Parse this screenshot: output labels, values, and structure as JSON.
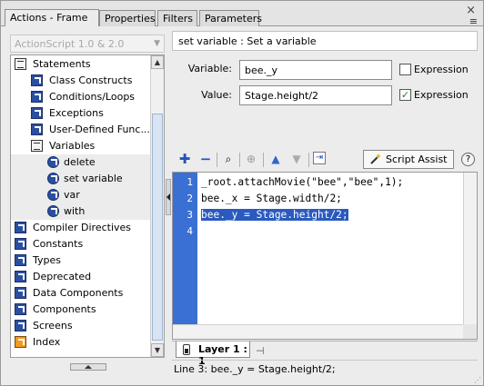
{
  "tabs": [
    {
      "label": "Actions - Frame"
    },
    {
      "label": "Properties"
    },
    {
      "label": "Filters"
    },
    {
      "label": "Parameters"
    }
  ],
  "version_select": {
    "value": "ActionScript 1.0 & 2.0"
  },
  "tree": [
    {
      "label": "Statements",
      "icon": "book-icon"
    },
    {
      "label": "Class Constructs",
      "icon": "action-icon"
    },
    {
      "label": "Conditions/Loops",
      "icon": "action-icon"
    },
    {
      "label": "Exceptions",
      "icon": "action-icon"
    },
    {
      "label": "User-Defined Func...",
      "icon": "action-icon"
    },
    {
      "label": "Variables",
      "icon": "book-icon"
    },
    {
      "label": "delete",
      "icon": "circle-action-icon"
    },
    {
      "label": "set variable",
      "icon": "circle-action-icon"
    },
    {
      "label": "var",
      "icon": "circle-action-icon"
    },
    {
      "label": "with",
      "icon": "circle-action-icon"
    },
    {
      "label": "Compiler Directives",
      "icon": "action-icon"
    },
    {
      "label": "Constants",
      "icon": "action-icon"
    },
    {
      "label": "Types",
      "icon": "action-icon"
    },
    {
      "label": "Deprecated",
      "icon": "action-icon"
    },
    {
      "label": "Data Components",
      "icon": "action-icon"
    },
    {
      "label": "Components",
      "icon": "action-icon"
    },
    {
      "label": "Screens",
      "icon": "action-icon"
    },
    {
      "label": "Index",
      "icon": "index-icon"
    }
  ],
  "description": "set variable : Set a variable",
  "variable": {
    "label": "Variable:",
    "value": "bee._y",
    "expression_label": "Expression",
    "expression_checked": false
  },
  "value": {
    "label": "Value:",
    "value": "Stage.height/2",
    "expression_label": "Expression",
    "expression_checked": true
  },
  "toolbar": {
    "script_assist_label": "Script Assist",
    "help": "?"
  },
  "code_lines": [
    {
      "n": "1",
      "text": "_root.attachMovie(\"bee\",\"bee\",1);"
    },
    {
      "n": "2",
      "text": "bee._x = Stage.width/2;"
    },
    {
      "n": "3",
      "text": "bee._y = Stage.height/2;"
    },
    {
      "n": "4",
      "text": ""
    }
  ],
  "layer_tab": "Layer 1 : 1",
  "status": "Line 3: bee._y = Stage.height/2;"
}
